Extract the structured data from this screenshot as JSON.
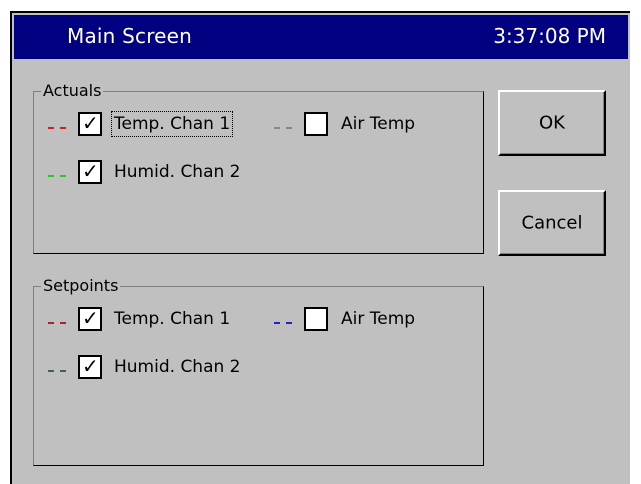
{
  "window": {
    "title": "Main Screen",
    "clock": "3:37:08 PM"
  },
  "colors": {
    "titlebar": "#000080",
    "background": "#c0c0c0",
    "actual_temp_chan1": "#cc2222",
    "actual_air_temp": "#888888",
    "actual_humid_chan2": "#22cc22",
    "setpoint_temp_chan1": "#aa2222",
    "setpoint_air_temp": "#2222cc",
    "setpoint_humid_chan2": "#336655"
  },
  "actuals": {
    "title": "Actuals",
    "items": [
      {
        "label": "Temp. Chan 1",
        "checked": true,
        "color": "#cc2222"
      },
      {
        "label": "Air Temp",
        "checked": false,
        "color": "#888888"
      },
      {
        "label": "Humid. Chan 2",
        "checked": true,
        "color": "#22cc22"
      }
    ]
  },
  "setpoints": {
    "title": "Setpoints",
    "items": [
      {
        "label": "Temp. Chan 1",
        "checked": true,
        "color": "#aa2222"
      },
      {
        "label": "Air Temp",
        "checked": false,
        "color": "#2222cc"
      },
      {
        "label": "Humid. Chan 2",
        "checked": true,
        "color": "#336655"
      }
    ]
  },
  "buttons": {
    "ok": "OK",
    "cancel": "Cancel"
  }
}
